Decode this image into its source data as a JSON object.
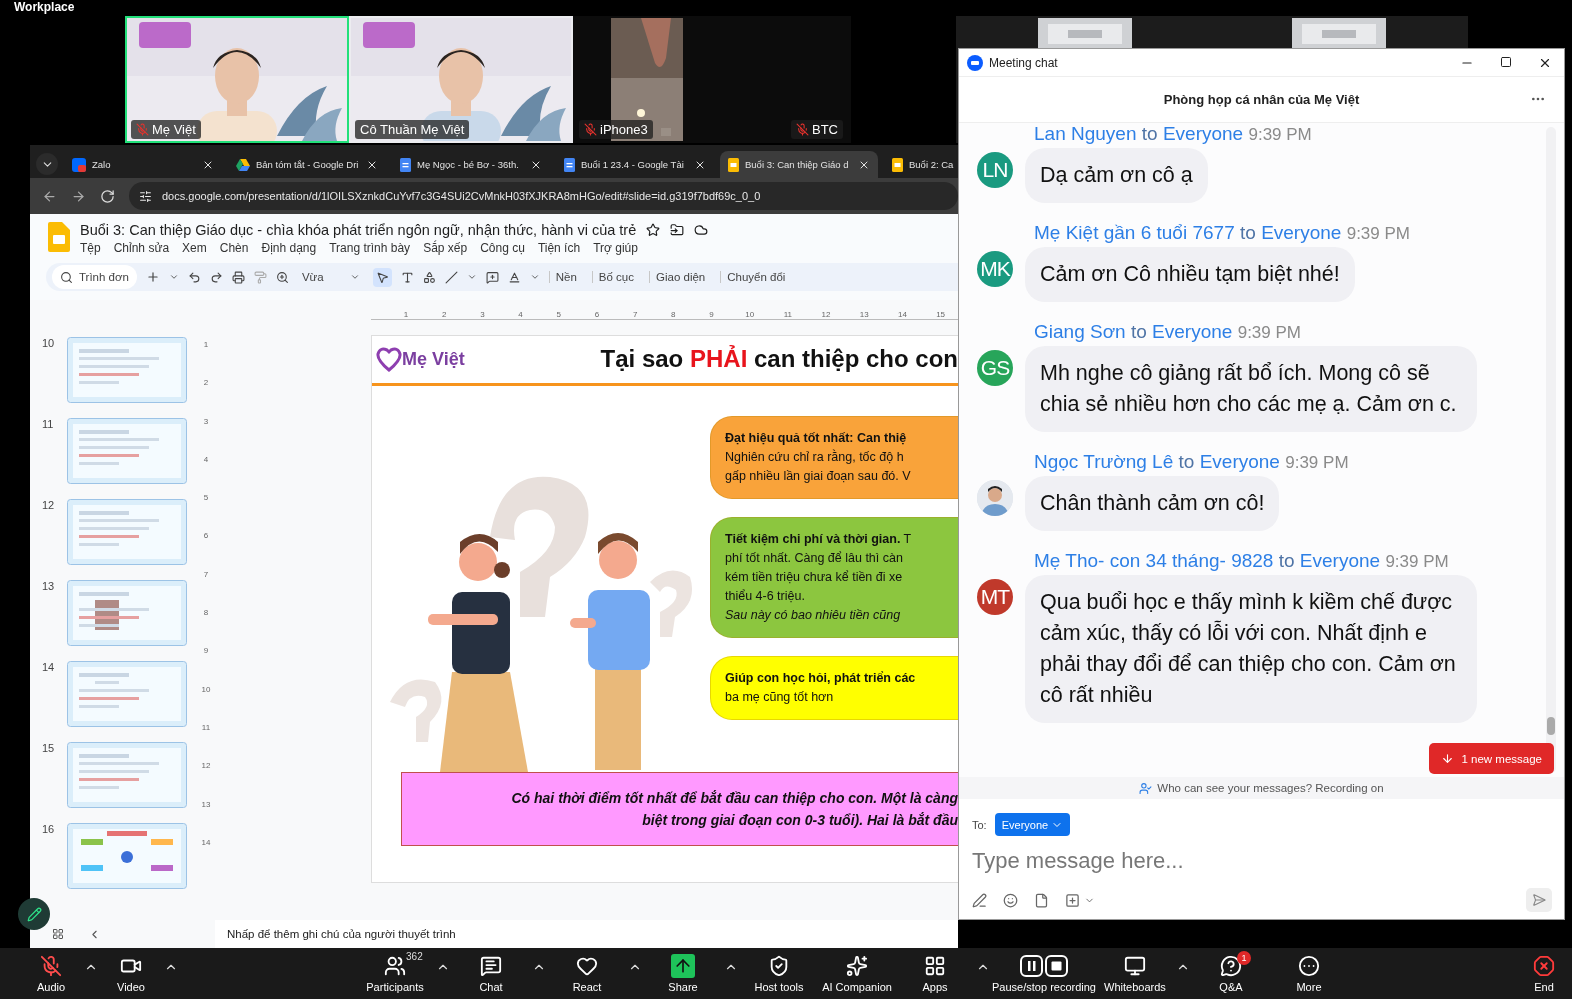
{
  "top_bar": {
    "title": "Workplace"
  },
  "video_tiles": [
    {
      "kind": "camera",
      "name": "Mẹ Việt",
      "muted": true,
      "speaking": true
    },
    {
      "kind": "camera",
      "name": "Cô Thuần Mẹ Việt",
      "muted": false,
      "speaking": false
    },
    {
      "kind": "portrait",
      "name": "iPhone3",
      "muted": true,
      "speaking": false
    },
    {
      "kind": "off",
      "name": "BTC",
      "muted": true,
      "speaking": false
    },
    {
      "kind": "covered",
      "speaking": false
    }
  ],
  "browser": {
    "tabs": [
      {
        "title": "Zalo",
        "selected": false
      },
      {
        "title": "Bản tóm tắt - Google Dri",
        "selected": false
      },
      {
        "title": "Mẹ Ngọc - bé Bơ - 36th.",
        "selected": false
      },
      {
        "title": "Buổi 1 23.4 - Google Tài",
        "selected": false
      },
      {
        "title": "Buổi 3: Can thiệp Giáo d",
        "selected": true
      },
      {
        "title": "Buổi 2: Ca",
        "selected": false
      }
    ],
    "url": "docs.google.com/presentation/d/1lOILSXznkdCuYvf7c3G4SUi2CvMnkH03fXJKRA8mHGo/edit#slide=id.g319f7bdf69c_0_0"
  },
  "slides": {
    "doc_title": "Buổi 3: Can thiệp Giáo dục - chìa khóa phát triển ngôn ngữ, nhận thức, hành vi của trẻ",
    "menu": [
      "Tệp",
      "Chỉnh sửa",
      "Xem",
      "Chèn",
      "Định dạng",
      "Trang trình bày",
      "Sắp xếp",
      "Công cụ",
      "Tiện ích",
      "Trợ giúp"
    ],
    "toolbar": {
      "search_placeholder": "Trình đơn",
      "zoom": "Vừa",
      "pointer_selected": true,
      "buttons": [
        "Nền",
        "Bố cục",
        "Giao diện",
        "Chuyển đổi"
      ]
    },
    "ruler_h": [
      "1",
      "2",
      "3",
      "4",
      "5",
      "6",
      "7",
      "8",
      "9",
      "10",
      "11",
      "12",
      "13",
      "14",
      "15"
    ],
    "ruler_v": [
      "1",
      "2",
      "3",
      "4",
      "5",
      "6",
      "7",
      "8",
      "9",
      "10",
      "11",
      "12",
      "13",
      "14"
    ],
    "thumbnails": [
      {
        "number": "10"
      },
      {
        "number": "11"
      },
      {
        "number": "12"
      },
      {
        "number": "13"
      },
      {
        "number": "14"
      },
      {
        "number": "15"
      },
      {
        "number": "16"
      }
    ],
    "slide": {
      "logo": "Mẹ Việt",
      "title": [
        {
          "text": "Tại sao ",
          "emphasis": false
        },
        {
          "text": "PHẢI",
          "emphasis": true
        },
        {
          "text": " can thiệp cho con",
          "emphasis": false
        }
      ],
      "boxes": [
        {
          "color": "#f9a33a",
          "lines": [
            "**Đạt hiệu quả tốt nhất: Can thiệ**",
            "Nghiên cứu chỉ ra rằng, tốc độ h",
            "gấp nhiều lần giai đoạn sau đó. V"
          ]
        },
        {
          "color": "#8cc63f",
          "lines": [
            "**Tiết kiệm chi phí và thời gian.** T",
            "phí tốt nhất. Càng để lâu thì càn",
            "kém tiền triệu chưa kể tiền đi xe",
            "thiểu 4-6 triệu.",
            "*Sau này có bao nhiêu tiền cũng*"
          ]
        },
        {
          "color": "#ffff00",
          "lines": [
            "**Giúp con học hỏi, phát triển các**",
            "ba mẹ cũng tốt hơn"
          ]
        }
      ],
      "footer_lines": [
        "Có hai thời điểm tốt nhất để bắt đầu can thiệp cho con. Một là càng",
        "biệt trong giai đoạn con 0-3 tuổi). Hai là bắt đầu"
      ]
    },
    "notes_placeholder": "Nhấp để thêm ghi chú của người thuyết trình"
  },
  "chat": {
    "title": "Meeting chat",
    "room": "Phòng họp cá nhân của Mẹ Việt",
    "messages": [
      {
        "sender": "Lan Nguyen",
        "to_word": "to",
        "recipient": "Everyone",
        "time": "9:39 PM",
        "avatar": {
          "kind": "initials",
          "initials": "LN",
          "color": "#1a9a80"
        },
        "text": "Dạ cảm ơn cô ạ"
      },
      {
        "sender": "Mẹ Kiệt gần 6 tuổi 7677",
        "to_word": "to",
        "recipient": "Everyone",
        "time": "9:39 PM",
        "avatar": {
          "kind": "initials",
          "initials": "MK",
          "color": "#1a9a80"
        },
        "text": "Cảm ơn Cô nhiều tạm biệt nhé!"
      },
      {
        "sender": "Giang Sơn",
        "to_word": "to",
        "recipient": "Everyone",
        "time": "9:39 PM",
        "avatar": {
          "kind": "initials",
          "initials": "GS",
          "color": "#27a55a"
        },
        "text": "Mh nghe cô giảng rất bổ ích. Mong cô sẽ chia sẻ nhiều hơn cho các mẹ ạ. Cảm ơn c."
      },
      {
        "sender": "Ngọc Trường Lê",
        "to_word": "to",
        "recipient": "Everyone",
        "time": "9:39 PM",
        "text": "Chân thành cảm ơn cô!"
      },
      {
        "sender": "Mẹ Tho- con 34 tháng- 9828",
        "to_word": "to",
        "recipient": "Everyone",
        "time": "9:39 PM",
        "avatar": {
          "kind": "initials",
          "initials": "MT",
          "color": "#c0392b"
        },
        "text": "Qua buổi học e thấy mình k kiềm chế được cảm xúc, thấy có lỗi với con. Nhất định e phải thay đổi để can thiệp cho con. Cảm ơn cô rất nhiều"
      }
    ],
    "new_message_button": "1 new message",
    "privacy_notice": "Who can see your messages? Recording on",
    "to_label": "To:",
    "recipient": "Everyone",
    "placeholder": "Type message here..."
  },
  "meeting_toolbar": [
    {
      "label": "Audio",
      "muted": true,
      "menu": true,
      "highlight": false
    },
    {
      "label": "Video",
      "menu": true,
      "highlight": false
    },
    {
      "label": "Participants",
      "count": "362",
      "menu": true,
      "highlight": false
    },
    {
      "label": "Chat",
      "menu": true,
      "highlight": false
    },
    {
      "label": "React",
      "menu": true,
      "highlight": false
    },
    {
      "label": "Share",
      "menu": true,
      "highlight": true
    },
    {
      "label": "Host tools",
      "menu": false,
      "highlight": false
    },
    {
      "label": "AI Companion",
      "menu": false,
      "highlight": false
    },
    {
      "label": "Apps",
      "menu": true,
      "highlight": false
    },
    {
      "label": "Pause/stop recording",
      "menu": false,
      "highlight": false
    },
    {
      "label": "Whiteboards",
      "menu": true,
      "highlight": false
    },
    {
      "label": "Q&A",
      "badge": "1",
      "menu": false,
      "highlight": false
    },
    {
      "label": "More",
      "menu": false,
      "highlight": false
    },
    {
      "label": "End",
      "menu": false,
      "highlight": false
    }
  ]
}
